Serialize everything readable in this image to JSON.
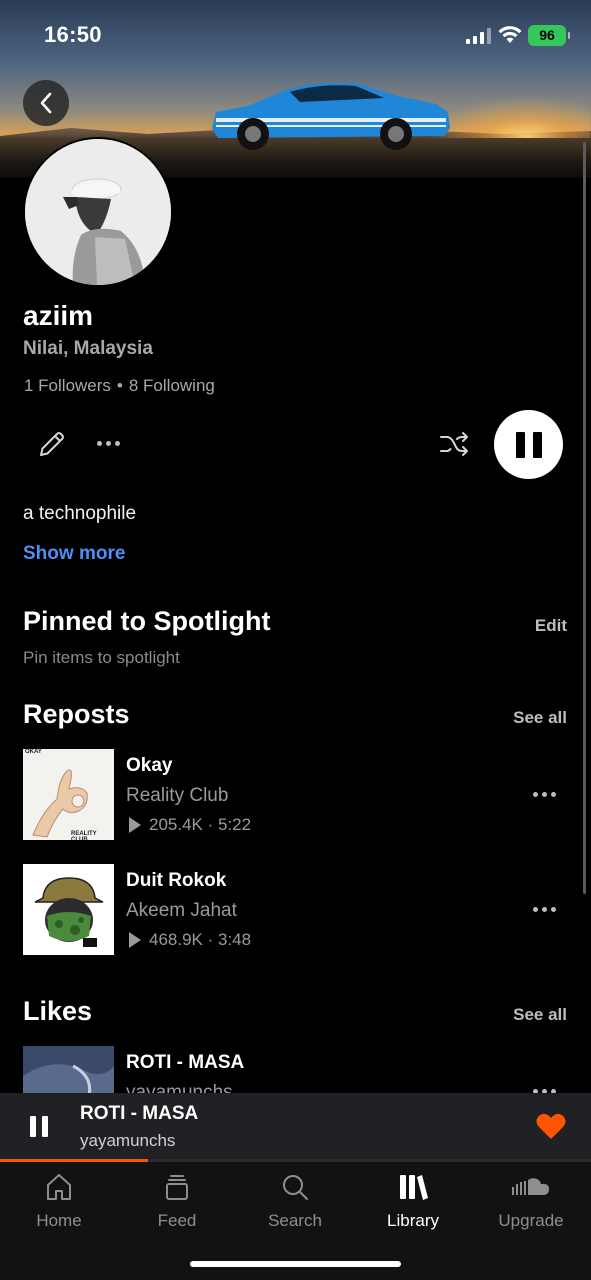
{
  "status_bar": {
    "time": "16:50",
    "battery": "96",
    "icons": [
      "signal-icon",
      "wifi-icon",
      "battery-icon"
    ]
  },
  "header": {
    "back_icon": "chevron-left-icon"
  },
  "profile": {
    "username": "aziim",
    "location": "Nilai, Malaysia",
    "followers": "1 Followers",
    "separator": "•",
    "following": "8 Following",
    "bio": "a technophile",
    "show_more": "Show more"
  },
  "actions": {
    "edit_icon": "pencil-icon",
    "more_icon": "more-icon",
    "shuffle_icon": "shuffle-icon",
    "play_state": "pause-icon"
  },
  "spotlight": {
    "title": "Pinned to Spotlight",
    "action": "Edit",
    "subtitle": "Pin items to spotlight"
  },
  "reposts": {
    "title": "Reposts",
    "action": "See all",
    "items": [
      {
        "title": "Okay",
        "artist": "Reality Club",
        "stats": "205.4K · 5:22",
        "art_text_top": "OKAY",
        "art_text_bottom": "REALITY CLUB"
      },
      {
        "title": "Duit Rokok",
        "artist": "Akeem Jahat",
        "stats": "468.9K · 3:48"
      }
    ]
  },
  "likes": {
    "title": "Likes",
    "action": "See all",
    "items": [
      {
        "title": "ROTI - MASA",
        "artist": "yayamunchs"
      }
    ]
  },
  "mini_player": {
    "title": "ROTI - MASA",
    "artist": "yayamunchs",
    "progress": 0.25,
    "heart_color": "#ff5500"
  },
  "tabs": [
    {
      "label": "Home",
      "icon": "home-icon",
      "active": false
    },
    {
      "label": "Feed",
      "icon": "feed-icon",
      "active": false
    },
    {
      "label": "Search",
      "icon": "search-icon",
      "active": false
    },
    {
      "label": "Library",
      "icon": "library-icon",
      "active": true
    },
    {
      "label": "Upgrade",
      "icon": "soundcloud-icon",
      "active": false
    }
  ],
  "colors": {
    "accent": "#ff5500",
    "link": "#4d8ff5",
    "battery": "#34c759"
  }
}
